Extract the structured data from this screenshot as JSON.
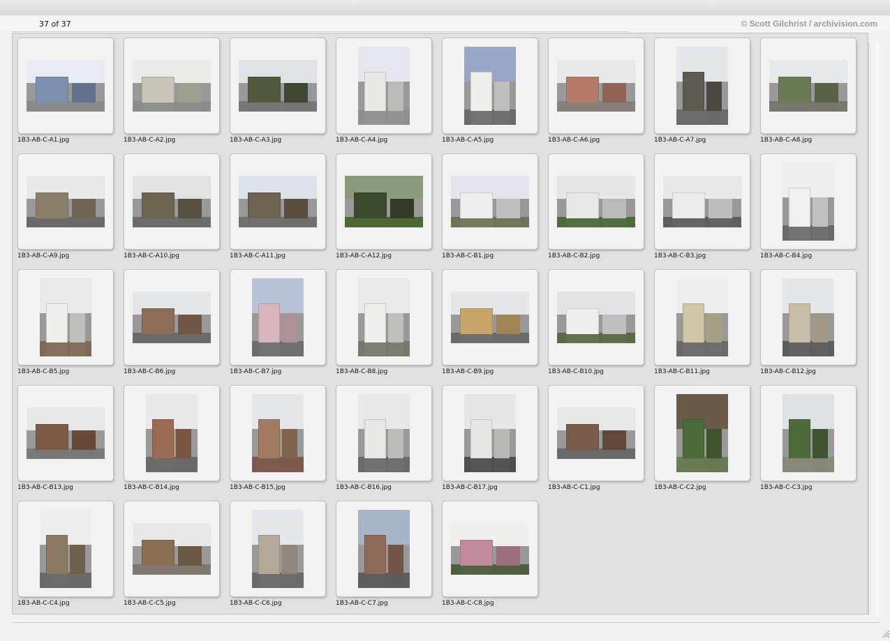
{
  "header": {
    "count": "37 of 37",
    "credit": "© Scott Gilchrist / archivision.com"
  },
  "thumbnails": [
    {
      "name": "1B3-AB-C-A1.jpg",
      "orientation": "landscape",
      "sky": "#e8ecf2",
      "building": "#7d8fb0",
      "ground": "#8a8a8a"
    },
    {
      "name": "1B3-AB-C-A2.jpg",
      "orientation": "landscape",
      "sky": "#e9ece6",
      "building": "#c9c4b8",
      "ground": "#8d8d88"
    },
    {
      "name": "1B3-AB-C-A3.jpg",
      "orientation": "landscape",
      "sky": "#dfe3e8",
      "building": "#4f5a3e",
      "ground": "#777"
    },
    {
      "name": "1B3-AB-C-A4.jpg",
      "orientation": "portrait",
      "sky": "#e4e8ee",
      "building": "#e9e9e4",
      "ground": "#8f8f8f"
    },
    {
      "name": "1B3-AB-C-A5.jpg",
      "orientation": "portrait",
      "sky": "#9aa6c6",
      "building": "#eeeeea",
      "ground": "#6a6a6a"
    },
    {
      "name": "1B3-AB-C-A6.jpg",
      "orientation": "landscape",
      "sky": "#e6e8ea",
      "building": "#b47a6a",
      "ground": "#85807a"
    },
    {
      "name": "1B3-AB-C-A7.jpg",
      "orientation": "portrait",
      "sky": "#e3e7ec",
      "building": "#5e5a52",
      "ground": "#6e6c6a"
    },
    {
      "name": "1B3-AB-C-A8.jpg",
      "orientation": "landscape",
      "sky": "#e5e8ea",
      "building": "#6c7a54",
      "ground": "#7a7670"
    },
    {
      "name": "1B3-AB-C-A9.jpg",
      "orientation": "landscape",
      "sky": "#e6e8ea",
      "building": "#8a7e6a",
      "ground": "#6a6a6a"
    },
    {
      "name": "1B3-AB-C-A10.jpg",
      "orientation": "landscape",
      "sky": "#dfe4e2",
      "building": "#6a6450",
      "ground": "#6d6d6d"
    },
    {
      "name": "1B3-AB-C-A11.jpg",
      "orientation": "landscape",
      "sky": "#dde2e8",
      "building": "#6e6250",
      "ground": "#707070"
    },
    {
      "name": "1B3-AB-C-A12.jpg",
      "orientation": "landscape",
      "sky": "#8a9a7a",
      "building": "#3e4a2c",
      "ground": "#4e6a34"
    },
    {
      "name": "1B3-AB-C-B1.jpg",
      "orientation": "landscape",
      "sky": "#e2e6ec",
      "building": "#eeeeee",
      "ground": "#6d7556"
    },
    {
      "name": "1B3-AB-C-B2.jpg",
      "orientation": "landscape",
      "sky": "#e4e6e8",
      "building": "#e8e8e8",
      "ground": "#4c6a3a"
    },
    {
      "name": "1B3-AB-C-B3.jpg",
      "orientation": "landscape",
      "sky": "#e6e8ea",
      "building": "#ececec",
      "ground": "#5e5e5e"
    },
    {
      "name": "1B3-AB-C-B4.jpg",
      "orientation": "portrait",
      "sky": "#eceef0",
      "building": "#f0f0ee",
      "ground": "#6a6a6a"
    },
    {
      "name": "1B3-AB-C-B5.jpg",
      "orientation": "portrait",
      "sky": "#e8eaea",
      "building": "#eeeeea",
      "ground": "#7e6a56"
    },
    {
      "name": "1B3-AB-C-B6.jpg",
      "orientation": "landscape",
      "sky": "#e4e7ea",
      "building": "#8e6d58",
      "ground": "#6a6a6a"
    },
    {
      "name": "1B3-AB-C-B7.jpg",
      "orientation": "portrait",
      "sky": "#b7c3d6",
      "building": "#d7b6bc",
      "ground": "#6e6e6e"
    },
    {
      "name": "1B3-AB-C-B8.jpg",
      "orientation": "portrait",
      "sky": "#e7e9ea",
      "building": "#eeeeea",
      "ground": "#7a786e"
    },
    {
      "name": "1B3-AB-C-B9.jpg",
      "orientation": "landscape",
      "sky": "#e4e7ea",
      "building": "#c8a46a",
      "ground": "#6a6a6a"
    },
    {
      "name": "1B3-AB-C-B10.jpg",
      "orientation": "landscape",
      "sky": "#dfe4e8",
      "building": "#eeeeee",
      "ground": "#5a6a44"
    },
    {
      "name": "1B3-AB-C-B11.jpg",
      "orientation": "portrait",
      "sky": "#eceeee",
      "building": "#cfc7a8",
      "ground": "#6a6a6a"
    },
    {
      "name": "1B3-AB-C-B12.jpg",
      "orientation": "portrait",
      "sky": "#e4e7ea",
      "building": "#c9bfa8",
      "ground": "#5d5d5d"
    },
    {
      "name": "1B3-AB-C-B13.jpg",
      "orientation": "landscape",
      "sky": "#e6e8ea",
      "building": "#7e5a44",
      "ground": "#7a7a7a"
    },
    {
      "name": "1B3-AB-C-B14.jpg",
      "orientation": "portrait",
      "sky": "#e6e8ea",
      "building": "#9a6a52",
      "ground": "#6a6a6a"
    },
    {
      "name": "1B3-AB-C-B15.jpg",
      "orientation": "portrait",
      "sky": "#e4e7ea",
      "building": "#a07a62",
      "ground": "#7d5a4e"
    },
    {
      "name": "1B3-AB-C-B16.jpg",
      "orientation": "portrait",
      "sky": "#e6e8ea",
      "building": "#e8e8e4",
      "ground": "#6a6a6a"
    },
    {
      "name": "1B3-AB-C-B17.jpg",
      "orientation": "portrait",
      "sky": "#e4e6e8",
      "building": "#e6e6e2",
      "ground": "#4e4e4e"
    },
    {
      "name": "1B3-AB-C-C1.jpg",
      "orientation": "landscape",
      "sky": "#e6e8ea",
      "building": "#7a5a48",
      "ground": "#6a6a6a"
    },
    {
      "name": "1B3-AB-C-C2.jpg",
      "orientation": "portrait",
      "sky": "#6a5a4a",
      "building": "#4c6a3a",
      "ground": "#6a7a54"
    },
    {
      "name": "1B3-AB-C-C3.jpg",
      "orientation": "portrait",
      "sky": "#dfe2e4",
      "building": "#4e6a3c",
      "ground": "#8a8a7a"
    },
    {
      "name": "1B3-AB-C-C4.jpg",
      "orientation": "portrait",
      "sky": "#eceeee",
      "building": "#8a7a62",
      "ground": "#6a6a6a"
    },
    {
      "name": "1B3-AB-C-C5.jpg",
      "orientation": "landscape",
      "sky": "#e8e8e6",
      "building": "#8a6d52",
      "ground": "#7e7a72"
    },
    {
      "name": "1B3-AB-C-C6.jpg",
      "orientation": "portrait",
      "sky": "#e3e6ea",
      "building": "#b4a898",
      "ground": "#6a6a6a"
    },
    {
      "name": "1B3-AB-C-C7.jpg",
      "orientation": "portrait",
      "sky": "#a6b4c8",
      "building": "#8e6a5a",
      "ground": "#5e5e5e"
    },
    {
      "name": "1B3-AB-C-C8.jpg",
      "orientation": "landscape",
      "sky": "#f0efec",
      "building": "#c28a9a",
      "ground": "#4e5e3e"
    }
  ]
}
